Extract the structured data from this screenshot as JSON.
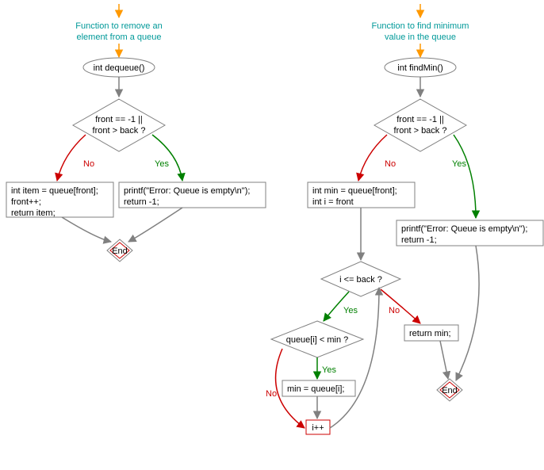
{
  "left": {
    "title1": "Function to remove an",
    "title2": "element from a queue",
    "start": "int dequeue()",
    "cond1": "front == -1 ||",
    "cond2": "front > back ?",
    "noBlock1": "int item = queue[front];",
    "noBlock2": "front++;",
    "noBlock3": "return item;",
    "yesBlock1": "printf(\"Error: Queue is empty\\n\");",
    "yesBlock2": "return -1;",
    "end": "End"
  },
  "right": {
    "title1": "Function to find minimum",
    "title2": "value in the queue",
    "start": "int findMin()",
    "cond1": "front == -1 ||",
    "cond2": "front > back ?",
    "noBlock1": "int min = queue[front];",
    "noBlock2": "int i = front",
    "yesBlock1": "printf(\"Error: Queue is empty\\n\");",
    "yesBlock2": "return -1;",
    "loopCond": "i <= back ?",
    "innerCond": "queue[i] < min ?",
    "assign": "min = queue[i];",
    "incr": "i++",
    "ret": "return min;",
    "end": "End"
  },
  "labels": {
    "yes": "Yes",
    "no": "No"
  },
  "colors": {
    "title": "#009999",
    "yes": "#008000",
    "no": "#cc0000",
    "arrow": "#808080",
    "orange": "#ff9900"
  }
}
